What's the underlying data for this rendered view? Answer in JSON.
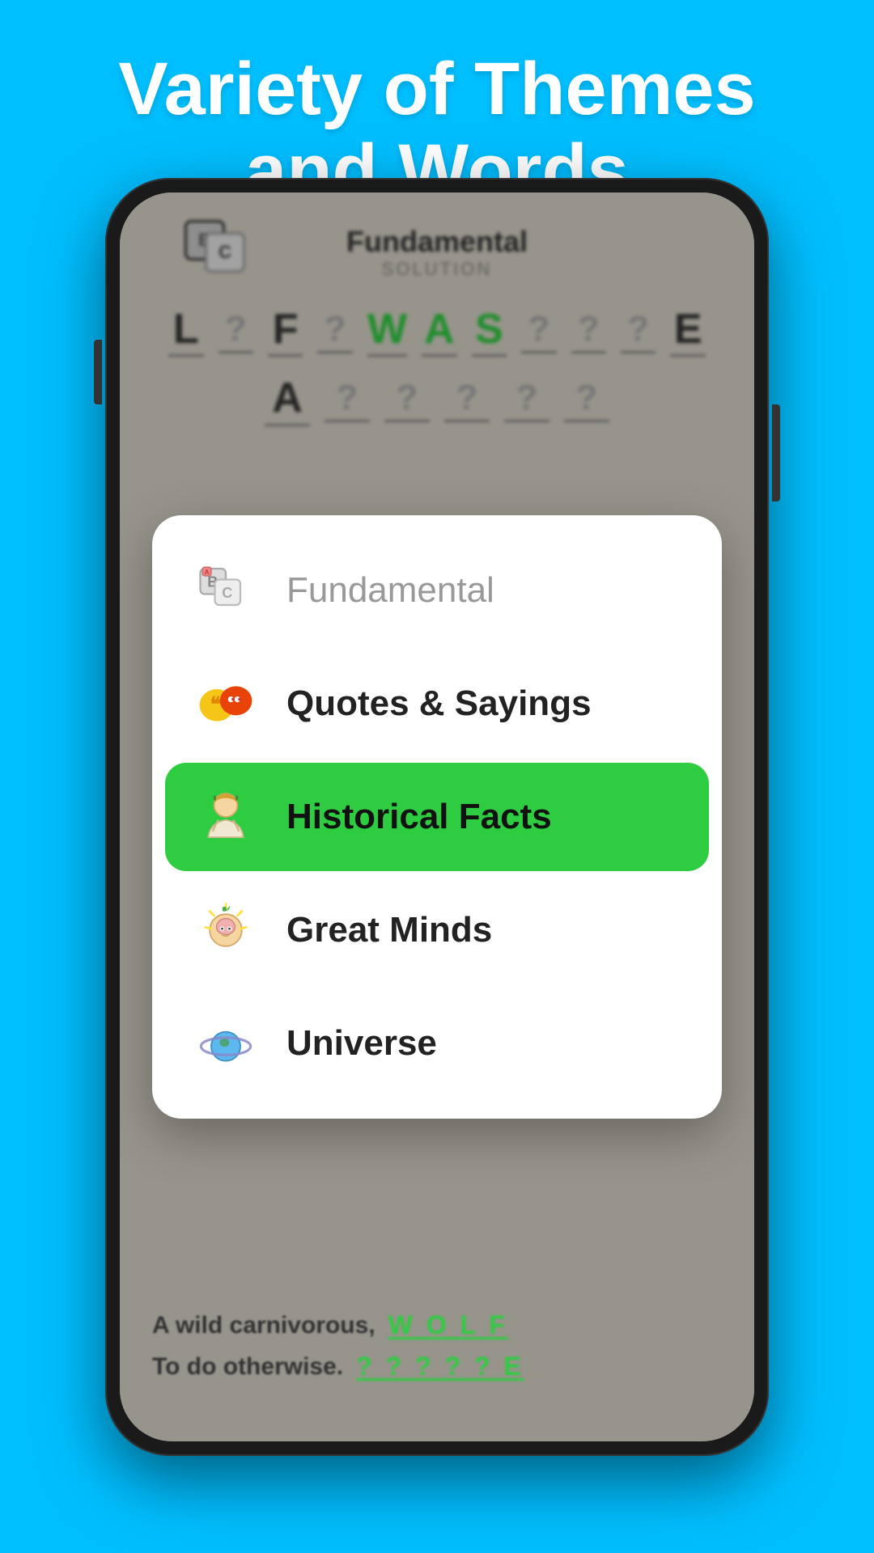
{
  "header": {
    "title": "Variety of Themes and Words",
    "bg_color": "#00bfff"
  },
  "game": {
    "title": "Fundamental",
    "subtitle": "SOLUTION",
    "row1": [
      "L",
      "?",
      "F",
      "?",
      "W",
      "A",
      "S",
      "?",
      "?",
      "?",
      "E"
    ],
    "row2": [
      "A",
      "?",
      "?",
      "?",
      "?",
      "?"
    ],
    "clues": [
      {
        "text": "A wild carnivorous,",
        "answer": "W O L F"
      },
      {
        "text": "To do otherwise.",
        "answer": "? ? ? ? ? E"
      }
    ]
  },
  "modal": {
    "items": [
      {
        "id": "fundamental",
        "label": "Fundamental",
        "active": false
      },
      {
        "id": "quotes",
        "label": "Quotes & Sayings",
        "active": false
      },
      {
        "id": "historical",
        "label": "Historical Facts",
        "active": true
      },
      {
        "id": "great-minds",
        "label": "Great Minds",
        "active": false
      },
      {
        "id": "universe",
        "label": "Universe",
        "active": false
      }
    ]
  }
}
